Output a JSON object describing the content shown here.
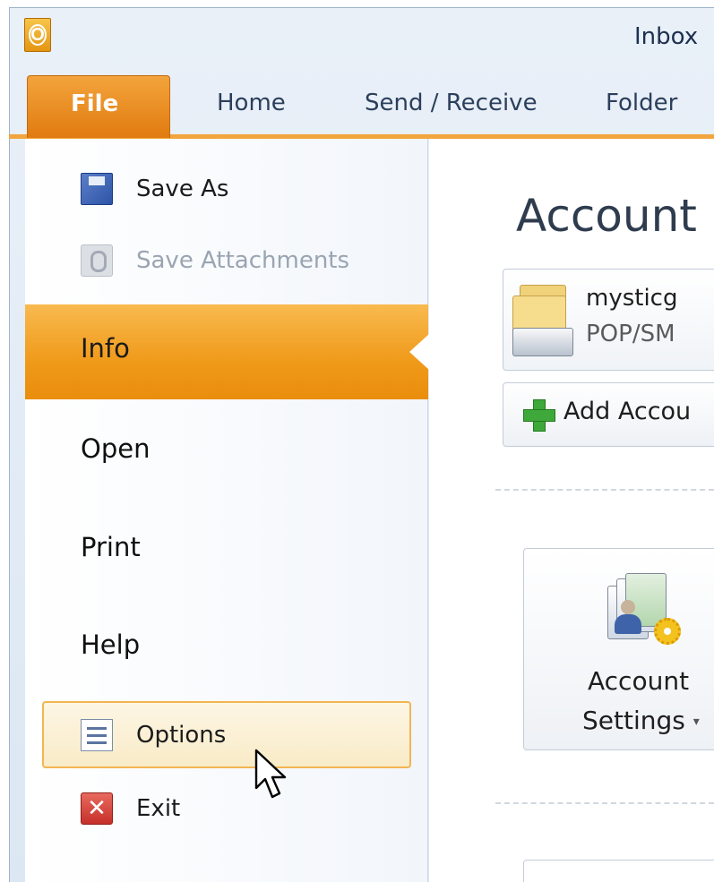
{
  "window": {
    "title": "Inbox",
    "app_icon_letter": "O"
  },
  "ribbon": {
    "tabs": [
      {
        "label": "File",
        "active": true
      },
      {
        "label": "Home"
      },
      {
        "label": "Send / Receive"
      },
      {
        "label": "Folder"
      }
    ],
    "accent_color": "#f09a1a"
  },
  "backstage": {
    "commands": [
      {
        "label": "Save As",
        "icon": "save-as-icon",
        "enabled": true
      },
      {
        "label": "Save Attachments",
        "icon": "save-attachments-icon",
        "enabled": false
      }
    ],
    "items": [
      {
        "label": "Info",
        "selected": true
      },
      {
        "label": "Open"
      },
      {
        "label": "Print"
      },
      {
        "label": "Help"
      }
    ],
    "bottom_commands": [
      {
        "label": "Options",
        "icon": "options-icon",
        "hovered": true
      },
      {
        "label": "Exit",
        "icon": "exit-icon"
      }
    ]
  },
  "info_panel": {
    "title": "Account",
    "account": {
      "name": "mysticg",
      "type": "POP/SM"
    },
    "add_account_label": "Add Accou",
    "account_settings": {
      "line1": "Account",
      "line2": "Settings"
    }
  }
}
